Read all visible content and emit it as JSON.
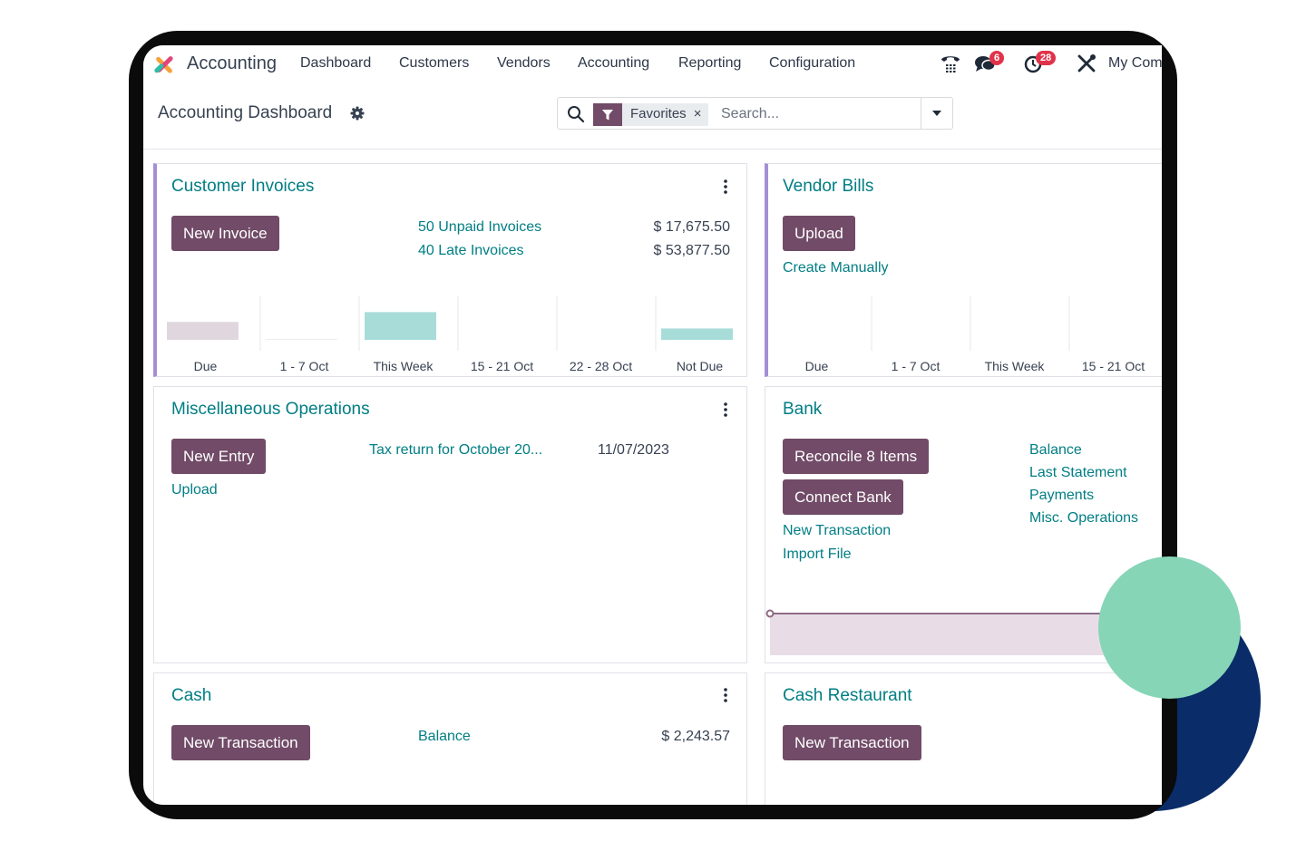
{
  "navbar": {
    "app_name": "Accounting",
    "menu": [
      "Dashboard",
      "Customers",
      "Vendors",
      "Accounting",
      "Reporting",
      "Configuration"
    ],
    "messages_count": "6",
    "activities_count": "28",
    "company": "My Company"
  },
  "control_panel": {
    "title": "Accounting Dashboard",
    "facet_label": "Favorites",
    "facet_close": "×",
    "search_placeholder": "Search..."
  },
  "cards": {
    "customer_invoices": {
      "title": "Customer Invoices",
      "button": "New Invoice",
      "rows": [
        {
          "label": "50 Unpaid Invoices",
          "amount": "$ 17,675.50"
        },
        {
          "label": "40 Late Invoices",
          "amount": "$ 53,877.50"
        }
      ],
      "chart_data": {
        "type": "bar",
        "categories": [
          "Due",
          "1 - 7 Oct",
          "This Week",
          "15 - 21 Oct",
          "22 - 28 Oct",
          "Not Due"
        ],
        "values": [
          0.55,
          0.03,
          0.85,
          0,
          0,
          0.35
        ],
        "colors": [
          "#e0d7de",
          "#eeeeee",
          "#a8dcd9",
          "#a8dcd9",
          "#a8dcd9",
          "#a8dcd9"
        ]
      }
    },
    "vendor_bills": {
      "title": "Vendor Bills",
      "button": "Upload",
      "link": "Create Manually",
      "chart_data": {
        "type": "bar",
        "categories": [
          "Due",
          "1 - 7 Oct",
          "This Week",
          "15 - 21 Oct"
        ],
        "values": [
          0,
          0,
          0,
          0
        ]
      }
    },
    "misc_operations": {
      "title": "Miscellaneous Operations",
      "button": "New Entry",
      "link": "Upload",
      "entry_label": "Tax return for October 20...",
      "entry_date": "11/07/2023"
    },
    "bank": {
      "title": "Bank",
      "buttons": [
        "Reconcile 8 Items",
        "Connect Bank"
      ],
      "links": [
        "New Transaction",
        "Import File"
      ],
      "side_links": [
        "Balance",
        "Last Statement",
        "Payments",
        "Misc. Operations"
      ],
      "chart_data": {
        "type": "area",
        "values": [
          1,
          1
        ],
        "line_color": "#8e6b86",
        "fill_color": "#e8dde6"
      }
    },
    "cash": {
      "title": "Cash",
      "button": "New Transaction",
      "balance_label": "Balance",
      "balance_amount": "$ 2,243.57"
    },
    "cash_restaurant": {
      "title": "Cash Restaurant",
      "button": "New Transaction"
    }
  }
}
